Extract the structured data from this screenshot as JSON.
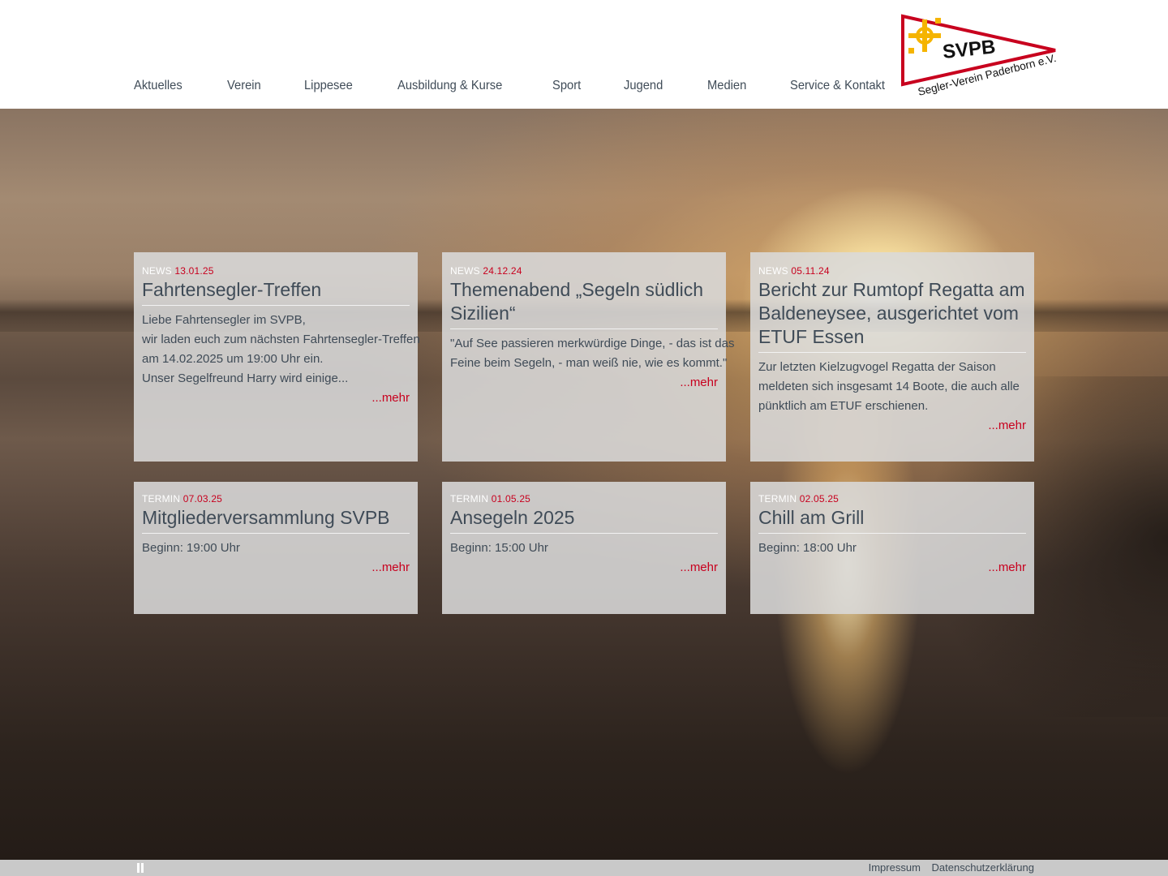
{
  "nav": {
    "items": [
      {
        "label": "Aktuelles"
      },
      {
        "label": "Verein"
      },
      {
        "label": "Lippesee"
      },
      {
        "label": "Ausbildung & Kurse"
      },
      {
        "label": "Sport"
      },
      {
        "label": "Jugend"
      },
      {
        "label": "Medien"
      },
      {
        "label": "Service & Kontakt"
      }
    ]
  },
  "logo": {
    "abbr": "SVPB",
    "name": "Segler-Verein Paderborn e.V.",
    "colors": {
      "red": "#c8001e",
      "yellow": "#f5b400",
      "black": "#111111"
    }
  },
  "news": [
    {
      "kind": "News",
      "date": "13.01.25",
      "title": "Fahrtensegler-Treffen",
      "lines": [
        "Liebe Fahrtensegler im SVPB,",
        "wir laden euch zum nächsten Fahrtensegler-Treffen",
        "am 14.02.2025 um 19:00 Uhr ein.",
        "Unser Segelfreund Harry wird einige..."
      ],
      "more": "...mehr"
    },
    {
      "kind": "News",
      "date": "24.12.24",
      "title_lines": [
        "Themenabend „Segeln südlich",
        "Sizilien“"
      ],
      "lines": [
        "\"Auf See passieren merkwürdige Dinge, - das ist das",
        "Feine beim Segeln, - man weiß nie, wie es kommt.\""
      ],
      "more": "...mehr"
    },
    {
      "kind": "News",
      "date": "05.11.24",
      "title_lines": [
        "Bericht zur Rumtopf Regatta am",
        "Baldeneysee, ausgerichtet vom",
        "ETUF Essen"
      ],
      "lines": [
        "Zur letzten Kielzugvogel Regatta der Saison",
        "meldeten sich insgesamt 14 Boote, die auch alle",
        "pünktlich am ETUF erschienen."
      ],
      "more": "...mehr"
    }
  ],
  "events": [
    {
      "kind": "Termin",
      "date": "07.03.25",
      "title": "Mitgliederversammlung SVPB",
      "begin": "Beginn: 19:00 Uhr",
      "more": "...mehr"
    },
    {
      "kind": "Termin",
      "date": "01.05.25",
      "title": "Ansegeln 2025",
      "begin": "Beginn: 15:00 Uhr",
      "more": "...mehr"
    },
    {
      "kind": "Termin",
      "date": "02.05.25",
      "title": "Chill am Grill",
      "begin": "Beginn: 18:00 Uhr",
      "more": "...mehr"
    }
  ],
  "footer": {
    "pause_icon": "pause-icon",
    "links": [
      "Impressum",
      "Datenschutzerklärung"
    ]
  }
}
